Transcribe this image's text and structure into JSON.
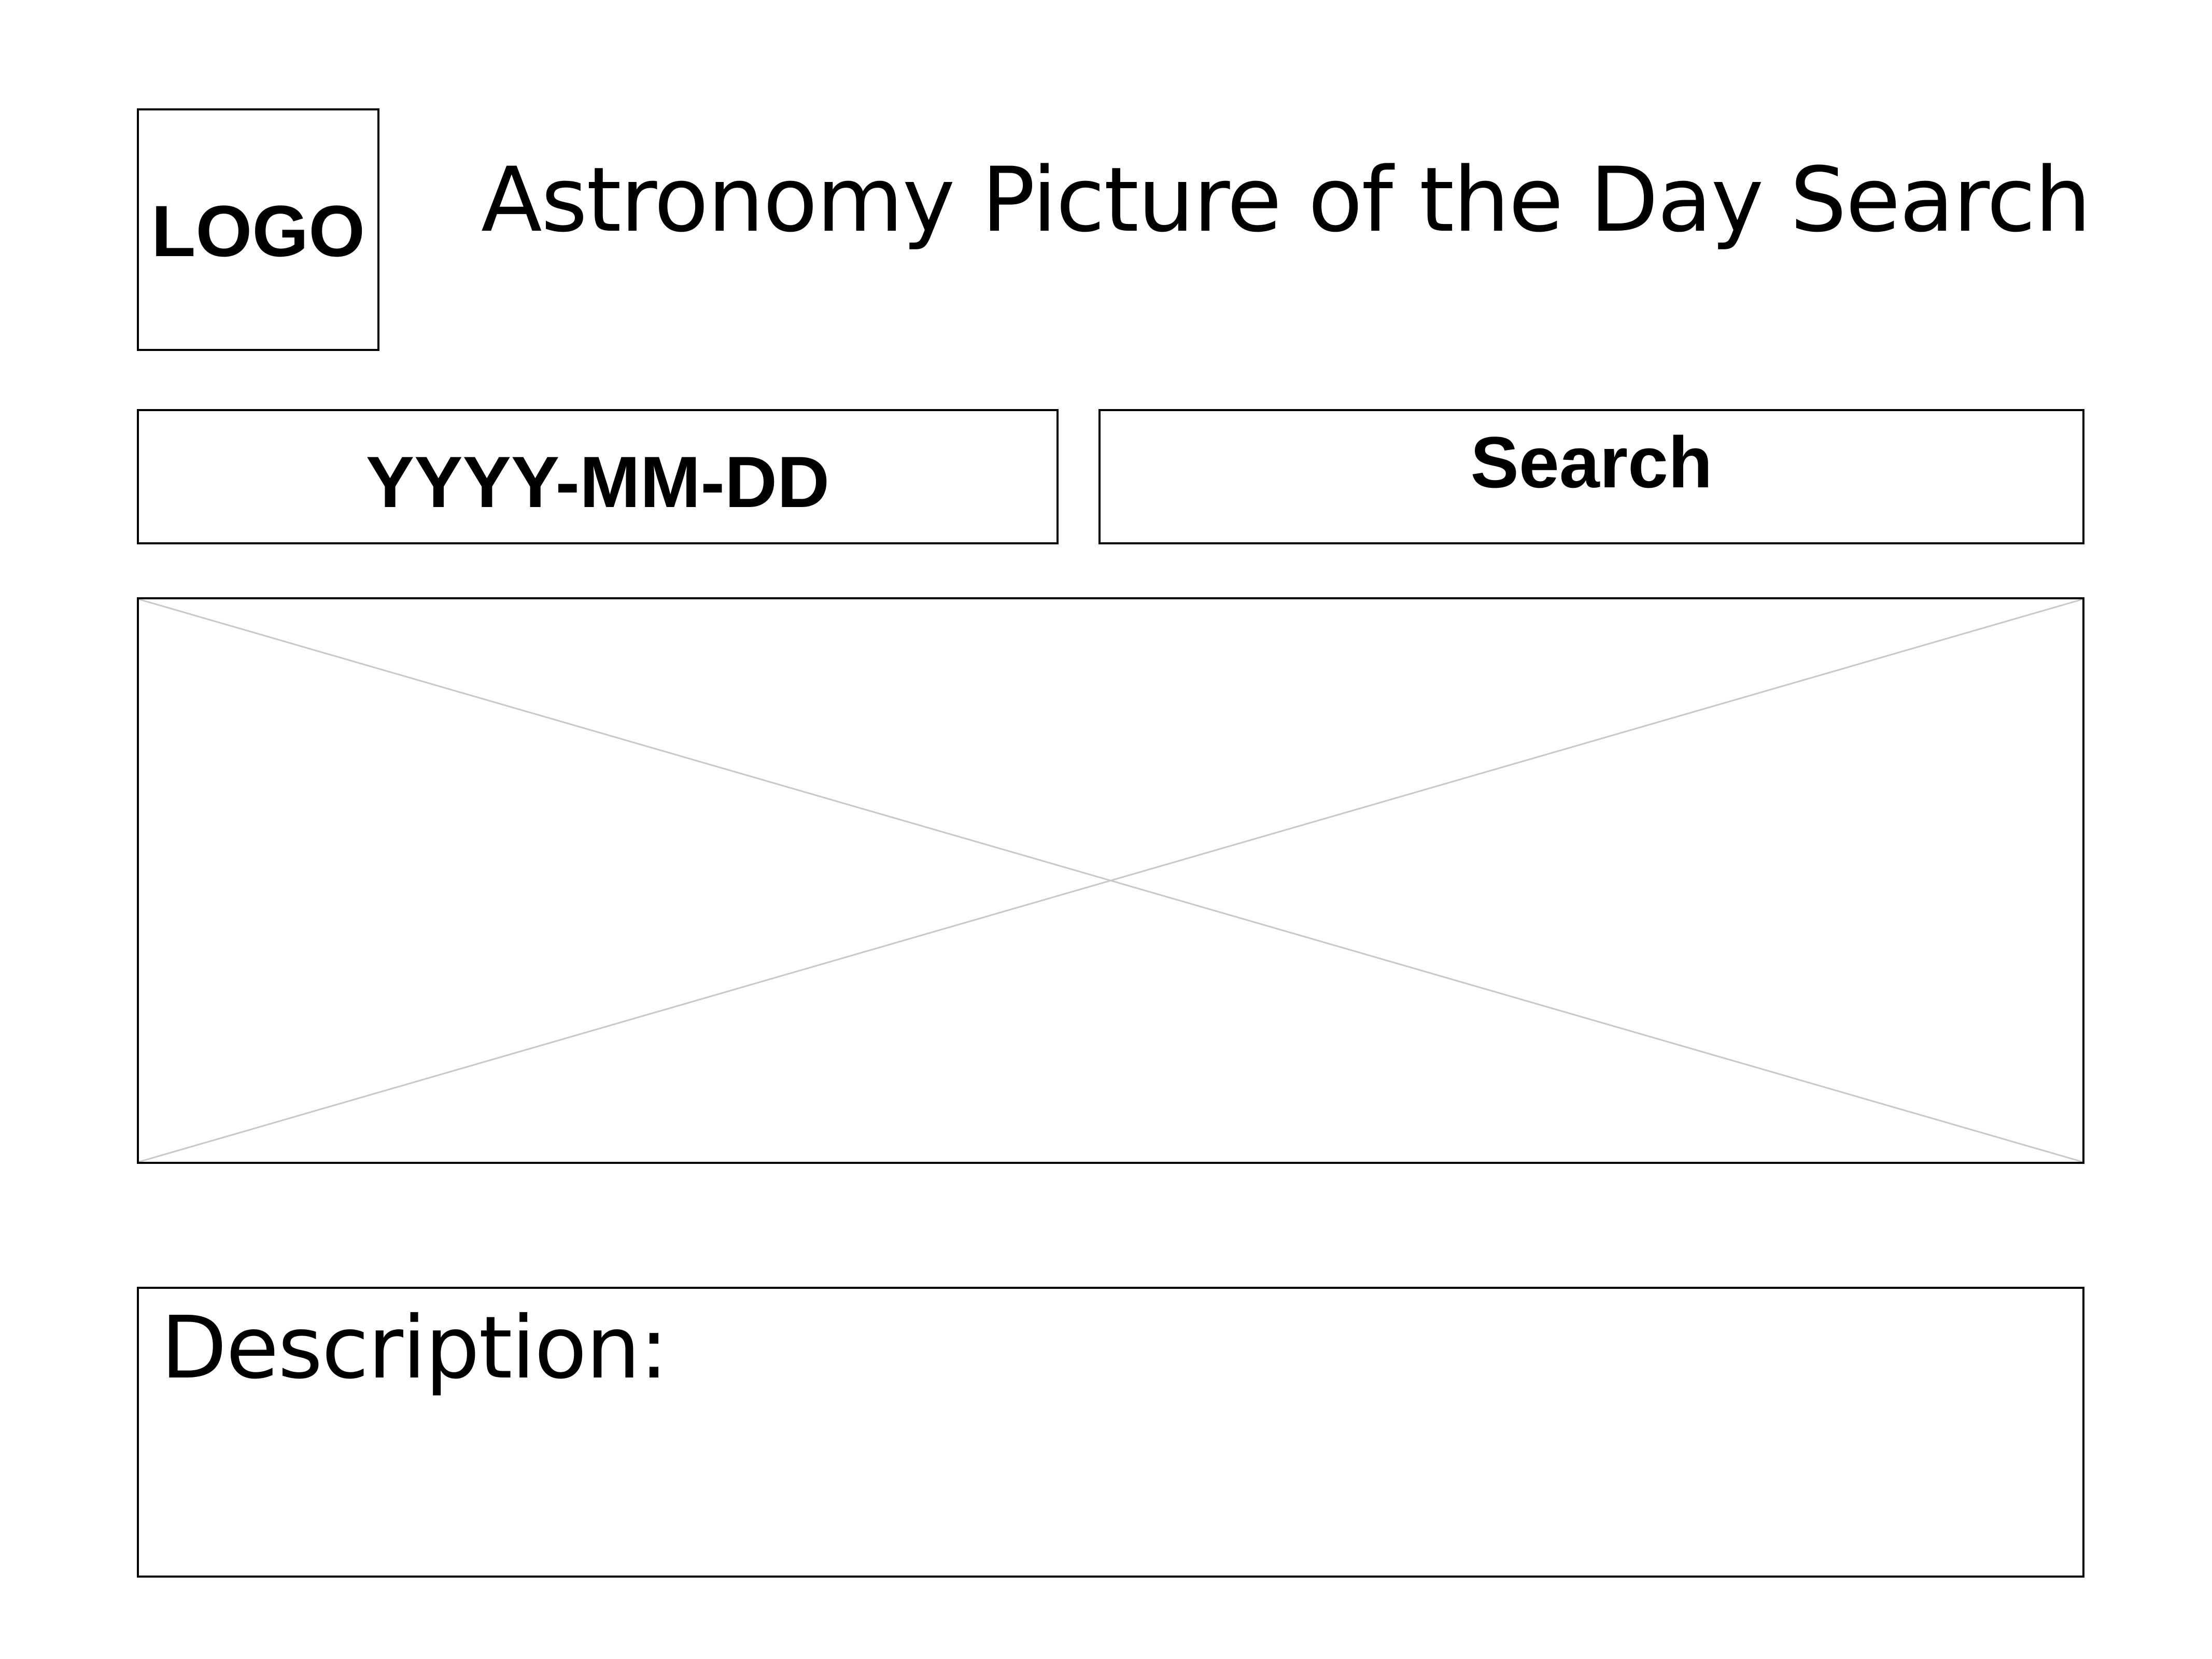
{
  "header": {
    "logo_text": "LOGO",
    "title": "Astronomy Picture of the Day Search"
  },
  "search": {
    "date_placeholder": "YYYY-MM-DD",
    "button_label": "Search"
  },
  "main": {
    "image_icon": "image-placeholder-cross-icon"
  },
  "description": {
    "label": "Description:"
  }
}
